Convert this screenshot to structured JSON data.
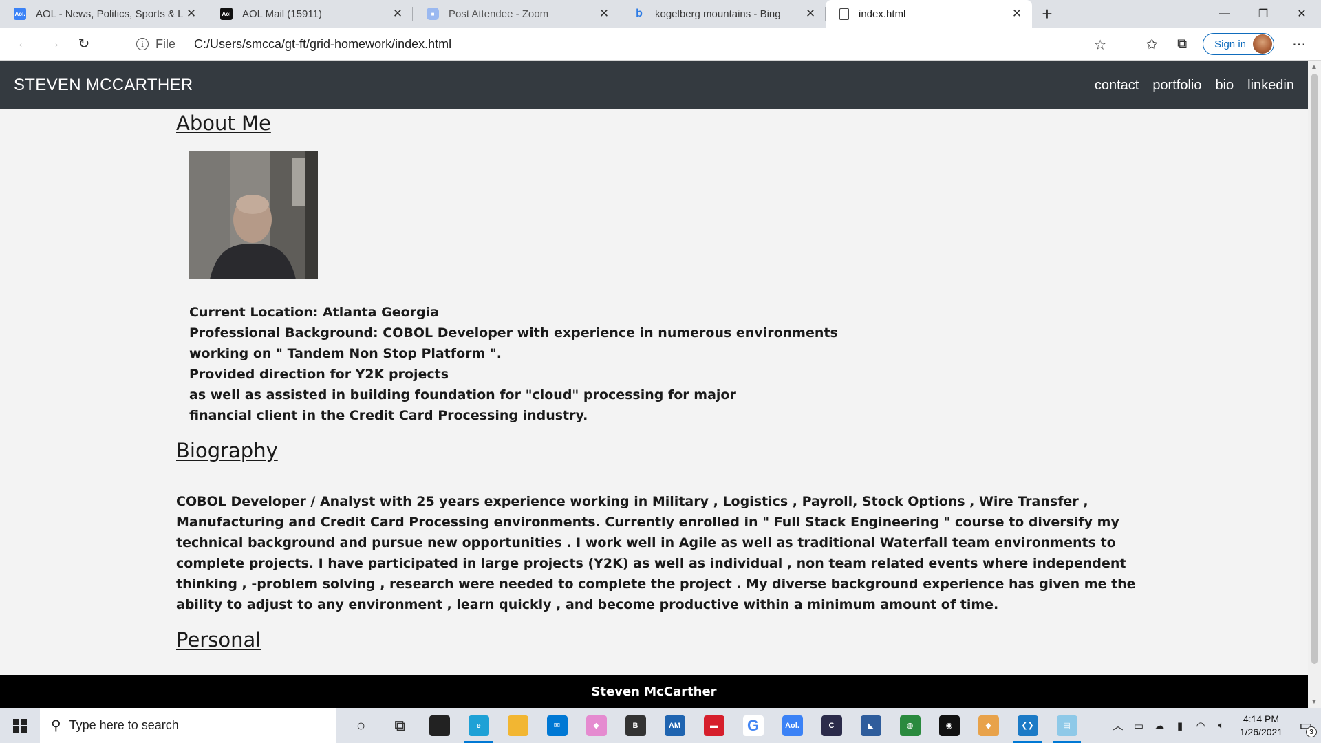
{
  "browser": {
    "tabs": [
      {
        "title": "AOL - News, Politics, Sports & La",
        "favicon": "aol-favicon",
        "color": "#3b82f6"
      },
      {
        "title": "AOL Mail (15911)",
        "favicon": "aol-mail-favicon",
        "color": "#111111"
      },
      {
        "title": "Post Attendee - Zoom",
        "favicon": "zoom-favicon",
        "color": "#9ab8f0"
      },
      {
        "title": "kogelberg mountains - Bing",
        "favicon": "bing-favicon",
        "color": "#2c7be5"
      },
      {
        "title": "index.html",
        "favicon": "file-favicon",
        "color": "#ffffff"
      }
    ],
    "address": {
      "scheme_label": "File",
      "url": "C:/Users/smcca/gt-ft/grid-homework/index.html"
    },
    "signin_label": "Sign in"
  },
  "page": {
    "brand": "STEVEN MCCARTHER",
    "nav": [
      "contact",
      "portfolio",
      "bio",
      "linkedin"
    ],
    "about": {
      "heading": "About Me",
      "lines": [
        "Current Location: Atlanta Georgia",
        "Professional Background: COBOL Developer with experience in numerous environments",
        "working on \" Tandem Non Stop Platform \".",
        "Provided direction for Y2K projects",
        "as well as assisted in building foundation for \"cloud\" processing for major",
        "financial client in the Credit Card Processing industry."
      ]
    },
    "biography": {
      "heading": "Biography",
      "text": "COBOL Developer / Analyst with 25 years experience working in Military , Logistics , Payroll, Stock Options , Wire Transfer , Manufacturing and Credit Card Processing environments. Currently enrolled in \" Full Stack Engineering \" course to diversify my technical background and pursue new opportunities . I work well in Agile as well as traditional Waterfall team environments to complete projects. I have participated in large projects (Y2K) as well as individual , non team related events where independent thinking , -problem solving , research were needed to complete the project . My diverse background experience has given me the ability to adjust to any environment , learn quickly , and become productive within a minimum amount of time."
    },
    "personal": {
      "heading": "Personal"
    },
    "footer": "Steven McCarther"
  },
  "taskbar": {
    "search_placeholder": "Type here to search",
    "time": "4:14 PM",
    "date": "1/26/2021",
    "notification_count": "3",
    "apps": [
      {
        "name": "cortana-icon",
        "color": "transparent",
        "glyph": "○"
      },
      {
        "name": "task-view-icon",
        "color": "transparent",
        "glyph": "⧉"
      },
      {
        "name": "store-icon",
        "color": "#222222",
        "glyph": ""
      },
      {
        "name": "edge-icon",
        "color": "#1ea1d6",
        "glyph": "e",
        "open": true
      },
      {
        "name": "file-explorer-icon",
        "color": "#f2b632",
        "glyph": ""
      },
      {
        "name": "mail-icon",
        "color": "#0078d4",
        "glyph": "✉"
      },
      {
        "name": "sketch-icon",
        "color": "#e58bd0",
        "glyph": "◆"
      },
      {
        "name": "b-app-icon",
        "color": "#333333",
        "glyph": "B"
      },
      {
        "name": "amex-icon",
        "color": "#1f64b0",
        "glyph": "AM"
      },
      {
        "name": "bank-icon",
        "color": "#d61f2c",
        "glyph": "▬"
      },
      {
        "name": "google-icon",
        "color": "#ffffff",
        "glyph": "G"
      },
      {
        "name": "aol-icon",
        "color": "#3b82f6",
        "glyph": "Aol."
      },
      {
        "name": "c-app-icon",
        "color": "#2b2b4a",
        "glyph": "C"
      },
      {
        "name": "sql-icon",
        "color": "#2f5d9c",
        "glyph": "◣"
      },
      {
        "name": "sourcetree-icon",
        "color": "#2a8a3e",
        "glyph": "◍"
      },
      {
        "name": "github-icon",
        "color": "#111111",
        "glyph": "◉"
      },
      {
        "name": "sketch2-icon",
        "color": "#e8a24a",
        "glyph": "◆"
      },
      {
        "name": "vscode-icon",
        "color": "#1b7ac6",
        "glyph": "❮❯",
        "open": true
      },
      {
        "name": "notepad-icon",
        "color": "#8ec9e8",
        "glyph": "▤",
        "open": true
      }
    ]
  }
}
